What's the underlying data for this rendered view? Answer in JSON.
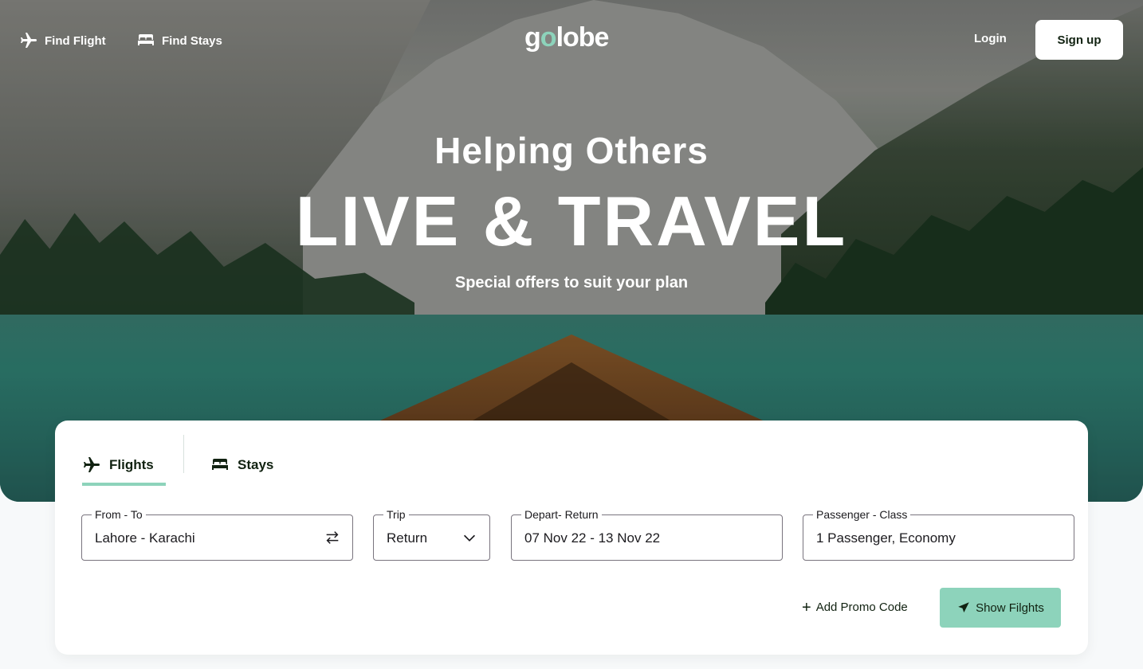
{
  "nav": {
    "find_flight": "Find Flight",
    "find_stays": "Find Stays",
    "logo_pre": "g",
    "logo_o": "o",
    "logo_post": "lobe",
    "login": "Login",
    "signup": "Sign up"
  },
  "hero": {
    "subtitle": "Helping Others",
    "title": "LIVE & TRAVEL",
    "tagline": "Special offers to suit your plan"
  },
  "search": {
    "tabs": [
      {
        "label": "Flights",
        "active": true
      },
      {
        "label": "Stays",
        "active": false
      }
    ],
    "fields": {
      "from_to": {
        "label": "From - To",
        "value": "Lahore - Karachi"
      },
      "trip": {
        "label": "Trip",
        "value": "Return"
      },
      "depart_return": {
        "label": "Depart- Return",
        "value": "07 Nov 22 - 13 Nov 22"
      },
      "passenger_class": {
        "label": "Passenger - Class",
        "value": "1 Passenger, Economy"
      }
    },
    "promo_label": "Add Promo Code",
    "submit_label": "Show Filghts"
  },
  "colors": {
    "accent": "#8dd3bb",
    "text": "#112211"
  }
}
